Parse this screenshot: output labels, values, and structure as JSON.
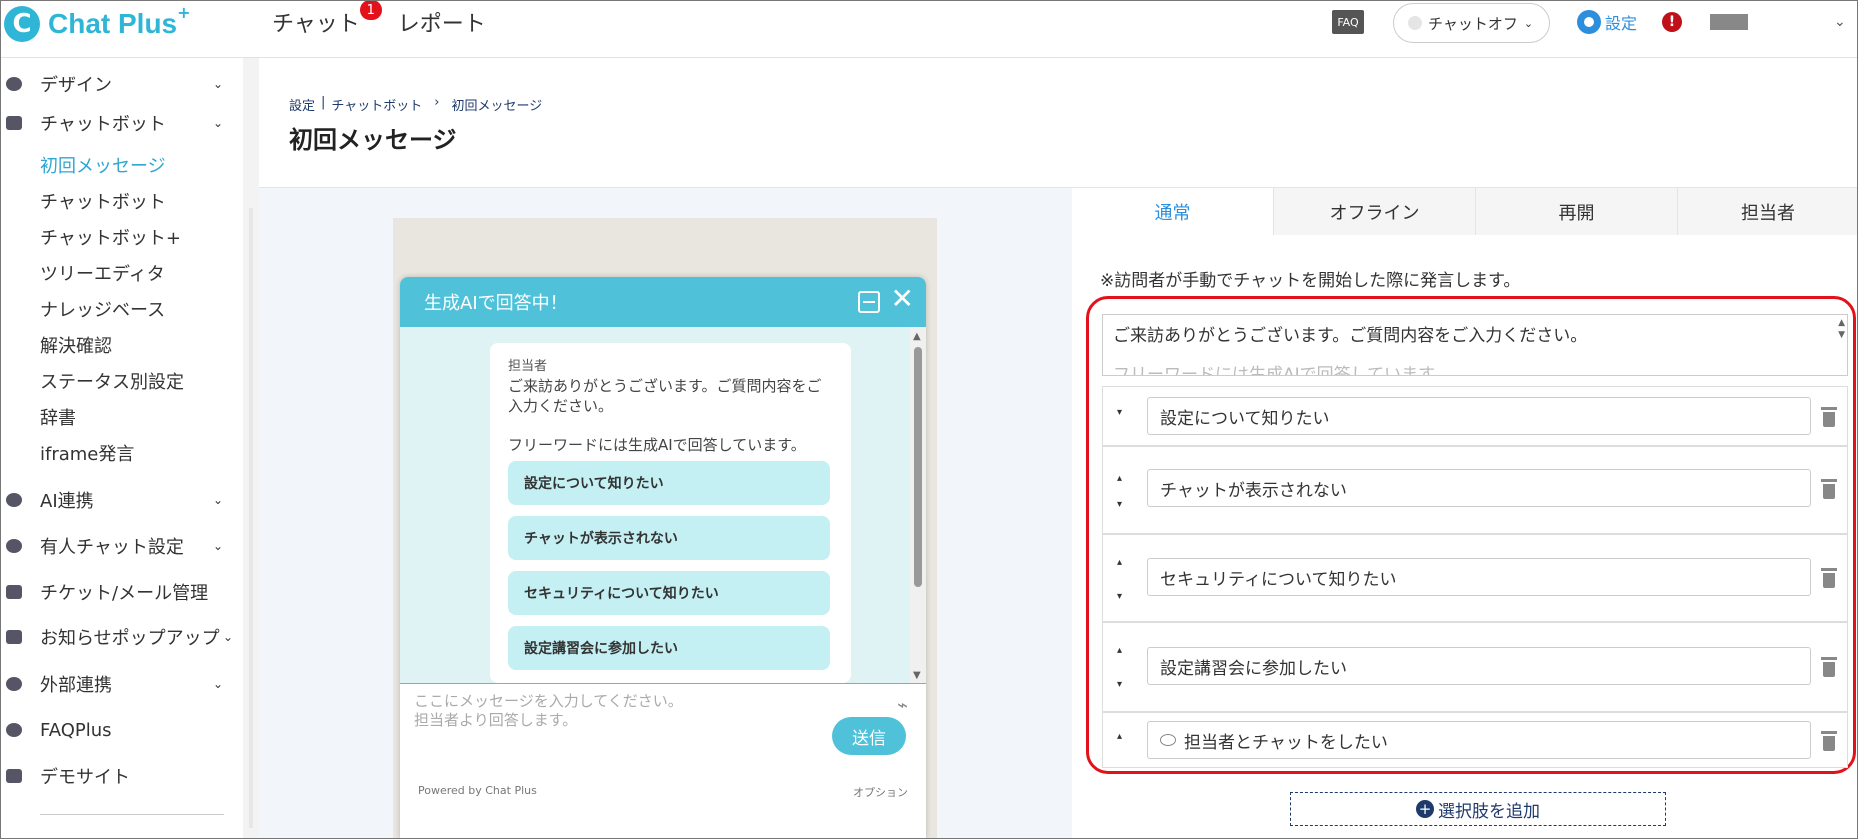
{
  "app": {
    "logo_badge": "C",
    "logo_text": "Chat Plus",
    "logo_plus": "+"
  },
  "topnav": {
    "chat": "チャット",
    "chat_badge": "1",
    "report": "レポート",
    "faq": "FAQ",
    "chat_status": "チャットオフ",
    "settings": "設定",
    "alert": "!"
  },
  "sidebar": {
    "design": "デザイン",
    "chatbot": "チャットボット",
    "sub": [
      "初回メッセージ",
      "チャットボット",
      "チャットボット+",
      "ツリーエディタ",
      "ナレッジベース",
      "解決確認",
      "ステータス別設定",
      "辞書",
      "iframe発言"
    ],
    "ai": "AI連携",
    "human_chat": "有人チャット設定",
    "ticket": "チケット/メール管理",
    "popup": "お知らせポップアップ",
    "external": "外部連携",
    "faqplus": "FAQPlus",
    "demo": "デモサイト"
  },
  "header": {
    "breadcrumb": [
      "設定",
      "|",
      "チャットボット",
      "›",
      "初回メッセージ"
    ],
    "title": "初回メッセージ"
  },
  "widget": {
    "title": "生成AIで回答中！",
    "sender": "担当者",
    "message": "ご来訪ありがとうございます。ご質問内容をご入力ください。",
    "message2": "フリーワードには生成AIで回答しています。",
    "choices": [
      "設定について知りたい",
      "チャットが表示されない",
      "セキュリティについて知りたい",
      "設定講習会に参加したい"
    ],
    "input_placeholder_1": "ここにメッセージを入力してください。",
    "input_placeholder_2": "担当者より回答します。",
    "send": "送信",
    "powered": "Powered by Chat Plus",
    "option": "オプション"
  },
  "panel": {
    "tabs": [
      "通常",
      "オフライン",
      "再開",
      "担当者"
    ],
    "note": "※訪問者が手動でチャットを開始した際に発言します。",
    "textarea_line1": "ご来訪ありがとうございます。ご質問内容をご入力ください。",
    "textarea_line2": "フリーワードには生成AIで回答しています。",
    "choices": [
      "設定について知りたい",
      "チャットが表示されない",
      "セキュリティについて知りたい",
      "設定講習会に参加したい",
      "担当者とチャットをしたい"
    ],
    "add_button": "選択肢を追加"
  },
  "colors": {
    "brand": "#2fb6d6",
    "accent": "#2c8fde",
    "widget": "#4fc2da",
    "highlight": "#e3121a"
  }
}
